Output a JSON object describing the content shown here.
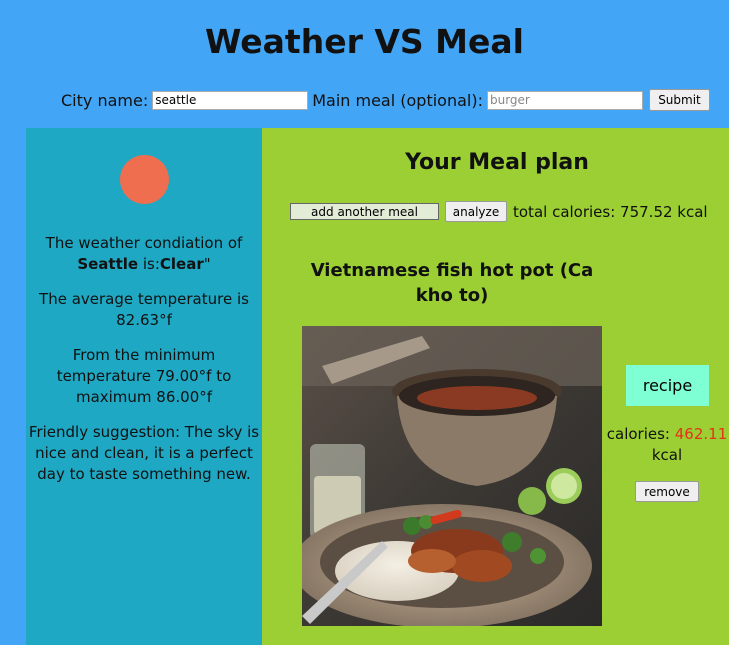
{
  "header": {
    "title": "Weather VS Meal",
    "city_label": "City name:",
    "city_value": "seattle",
    "meal_label": "Main meal (optional):",
    "meal_placeholder": "burger",
    "submit_label": "Submit"
  },
  "weather": {
    "icon": "sun-icon",
    "icon_color": "#ef6e50",
    "condition_prefix": "The weather condiation of",
    "city": "Seattle",
    "is_text": " is:",
    "condition": "Clear",
    "condition_suffix": "\"",
    "avg_temp_text": "The average temperature is 82.63°f",
    "range_text": "From the minimum temperature 79.00°f to maximum 86.00°f",
    "suggestion": "Friendly suggestion: The sky is nice and clean, it is a perfect day to taste something new."
  },
  "meal_plan": {
    "heading": "Your Meal plan",
    "add_meal_label": "add another meal",
    "analyze_label": "analyze",
    "total_calories_text": "total calories: 757.52 kcal",
    "meals": [
      {
        "name": "Vietnamese fish hot pot (Ca kho to)",
        "recipe_label": "recipe",
        "calories_label": "calories:",
        "calories_value": "462.11",
        "calories_unit": "kcal",
        "remove_label": "remove"
      }
    ]
  },
  "colors": {
    "page_bg": "#42a5f5",
    "weather_panel_bg": "#1ea8c4",
    "meal_panel_bg": "#9ccf33",
    "recipe_button_bg": "#7fffd4",
    "calorie_value": "#e53219"
  }
}
